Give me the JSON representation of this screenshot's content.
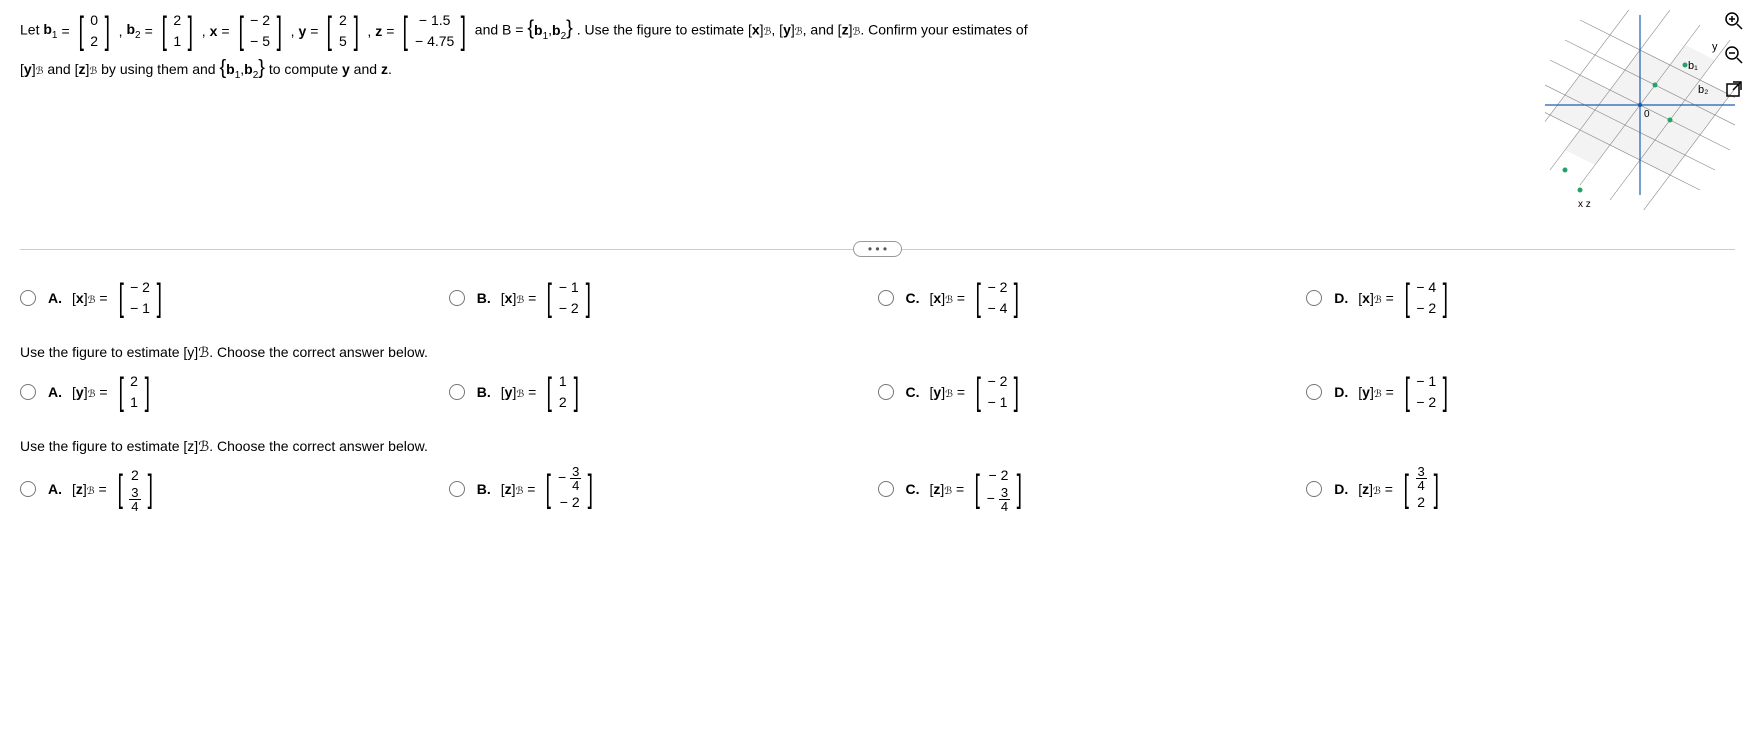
{
  "problem": {
    "b1_label": "b",
    "b1_sub": "1",
    "b2_label": "b",
    "b2_sub": "2",
    "x_label": "x",
    "y_label": "y",
    "z_label": "z",
    "B_label": "B",
    "eq": "=",
    "let": "Let ",
    "and_B": " and B = ",
    "set_open": "{",
    "set_close": "}",
    "b1_v": [
      "0",
      "2"
    ],
    "b2_v": [
      "2",
      "1"
    ],
    "x_v": [
      "− 2",
      "− 5"
    ],
    "y_v": [
      "2",
      "5"
    ],
    "z_v": [
      "− 1.5",
      "− 4.75"
    ],
    "tail1": ". Use the figure to estimate [",
    "xB": "x",
    "yB": "y",
    "zB": "z",
    "tail2": ". Confirm your estimates of",
    "line2a": " and ",
    "line2b": " by using them and ",
    "line2c": " to compute ",
    "line2d": " and ",
    "period": "."
  },
  "fig": {
    "labels": {
      "y": "y",
      "b1": "b₁",
      "b2": "b₂",
      "o": "0",
      "xz": "x z"
    }
  },
  "divider": "• • •",
  "q_y": "Use the figure to estimate [y]ℬ. Choose the correct answer below.",
  "q_z": "Use the figure to estimate [z]ℬ. Choose the correct answer below.",
  "labels": {
    "A": "A.",
    "B": "B.",
    "C": "C.",
    "D": "D."
  },
  "literal": {
    "xB": "x",
    "yB": "y",
    "zB": "z",
    "Bsub": "ℬ",
    "open": "[",
    "close": "]",
    "eq": " = "
  },
  "Q1": {
    "A": [
      "− 2",
      "− 1"
    ],
    "B": [
      "− 1",
      "− 2"
    ],
    "C": [
      "− 2",
      "− 4"
    ],
    "D": [
      "− 4",
      "− 2"
    ]
  },
  "Q2": {
    "A": [
      "2",
      "1"
    ],
    "B": [
      "1",
      "2"
    ],
    "C": [
      "− 2",
      "− 1"
    ],
    "D": [
      "− 1",
      "− 2"
    ]
  },
  "Q3": {
    "A": {
      "r1": "2",
      "r2_num": "3",
      "r2_den": "4",
      "r2_neg": false
    },
    "B": {
      "r1_neg": true,
      "r1_num": "3",
      "r1_den": "4",
      "r2": "− 2"
    },
    "C": {
      "r1": "− 2",
      "r2_neg": true,
      "r2_num": "3",
      "r2_den": "4"
    },
    "D": {
      "r1_num": "3",
      "r1_den": "4",
      "r2": "2"
    }
  }
}
